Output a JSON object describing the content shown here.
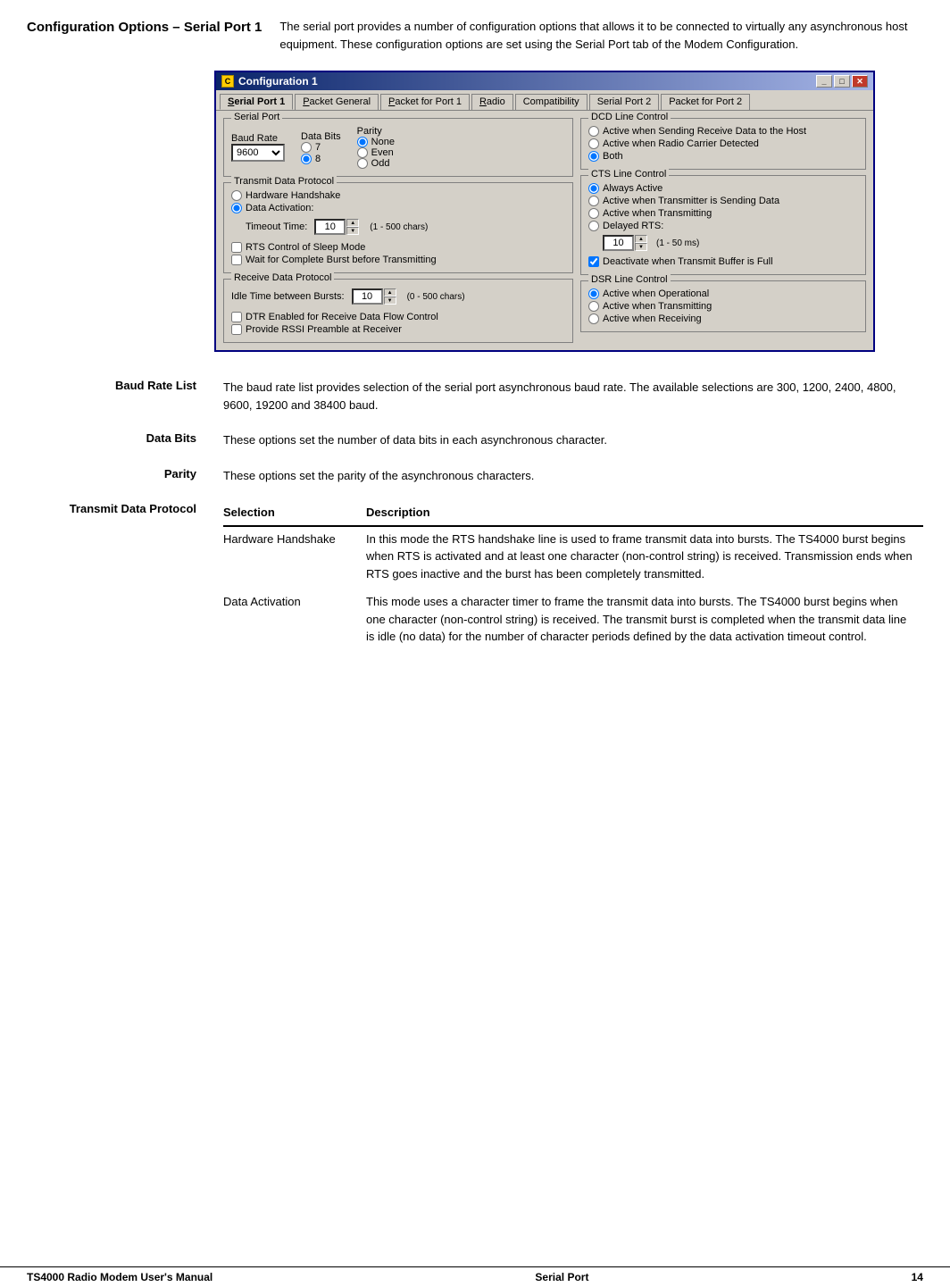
{
  "page": {
    "title": "Configuration Options – Serial Port 1",
    "description": "The serial port provides a number of configuration options that allows it to be connected to virtually any asynchronous host equipment.  These configuration options are set using the Serial Port tab of the Modem Configuration.",
    "footer": {
      "left": "TS4000 Radio Modem User's Manual",
      "center": "Serial Port",
      "right": "14"
    }
  },
  "dialog": {
    "title": "Configuration 1",
    "tabs": [
      {
        "label": "Serial Port 1",
        "underline": "S",
        "active": true
      },
      {
        "label": "Packet General",
        "underline": "P"
      },
      {
        "label": "Packet for Port 1",
        "underline": "P"
      },
      {
        "label": "Radio",
        "underline": "R"
      },
      {
        "label": "Compatibility",
        "underline": ""
      },
      {
        "label": "Serial Port 2",
        "underline": ""
      },
      {
        "label": "Packet for Port 2",
        "underline": ""
      }
    ],
    "serial_port": {
      "title": "Serial Port",
      "baud_rate": {
        "label": "Baud Rate",
        "value": "9600",
        "options": [
          "300",
          "1200",
          "2400",
          "4800",
          "9600",
          "19200",
          "38400"
        ]
      },
      "data_bits": {
        "label": "Data Bits",
        "options": [
          "7",
          "8"
        ],
        "selected": "8"
      },
      "parity": {
        "label": "Parity",
        "options": [
          "None",
          "Even",
          "Odd"
        ],
        "selected": "None"
      }
    },
    "transmit_data_protocol": {
      "title": "Transmit Data Protocol",
      "options": [
        "Hardware Handshake",
        "Data Activation:"
      ],
      "selected": "Data Activation:",
      "timeout_time": {
        "label": "Timeout Time:",
        "value": "10",
        "hint": "(1 - 500 chars)"
      },
      "rts_sleep": "RTS Control of Sleep Mode",
      "wait_burst": "Wait for Complete Burst before Transmitting"
    },
    "receive_data_protocol": {
      "title": "Receive Data Protocol",
      "idle_time": {
        "label": "Idle Time between Bursts:",
        "value": "10",
        "hint": "(0 - 500 chars)"
      },
      "dtr_enabled": "DTR Enabled for Receive Data Flow Control",
      "provide_rssi": "Provide RSSI Preamble at Receiver"
    },
    "dcd_line_control": {
      "title": "DCD Line Control",
      "options": [
        "Active when Sending Receive Data to the Host",
        "Active when Radio Carrier Detected",
        "Both"
      ],
      "selected": "Both"
    },
    "cts_line_control": {
      "title": "CTS Line Control",
      "options": [
        "Always Active",
        "Active when Transmitter is Sending Data",
        "Active when Transmitting",
        "Delayed RTS:"
      ],
      "selected": "Always Active",
      "delayed_rts_value": "10",
      "delayed_rts_hint": "(1 - 50 ms)",
      "deactivate": "Deactivate when Transmit Buffer is Full",
      "deactivate_checked": true
    },
    "dsr_line_control": {
      "title": "DSR Line Control",
      "options": [
        "Active when Operational",
        "Active when Transmitting",
        "Active when Receiving"
      ],
      "selected": "Active when Operational"
    }
  },
  "sections": {
    "baud_rate_list": {
      "label": "Baud Rate List",
      "text": "The baud rate list provides selection of the serial port asynchronous baud rate. The available selections are 300, 1200, 2400, 4800, 9600, 19200 and 38400 baud."
    },
    "data_bits": {
      "label": "Data Bits",
      "text": "These options set the number of data bits in each asynchronous character."
    },
    "parity": {
      "label": "Parity",
      "text": "These options set the parity of the asynchronous characters."
    },
    "transmit_data_protocol": {
      "label": "Transmit Data Protocol",
      "table": {
        "col1": "Selection",
        "col2": "Description",
        "rows": [
          {
            "selection": "Hardware Handshake",
            "description": "In this mode the RTS handshake line is used to frame transmit data into bursts. The TS4000 burst begins when RTS is activated and at least one character (non-control string) is received. Transmission ends when RTS goes inactive and the burst has been completely transmitted."
          },
          {
            "selection": "Data Activation",
            "description": "This mode uses a character timer to frame the transmit data into bursts.  The TS4000 burst begins when one character (non-control string) is received. The transmit burst is completed when the transmit data line is idle (no data) for the number of character periods defined by the data activation timeout control."
          }
        ]
      }
    }
  }
}
